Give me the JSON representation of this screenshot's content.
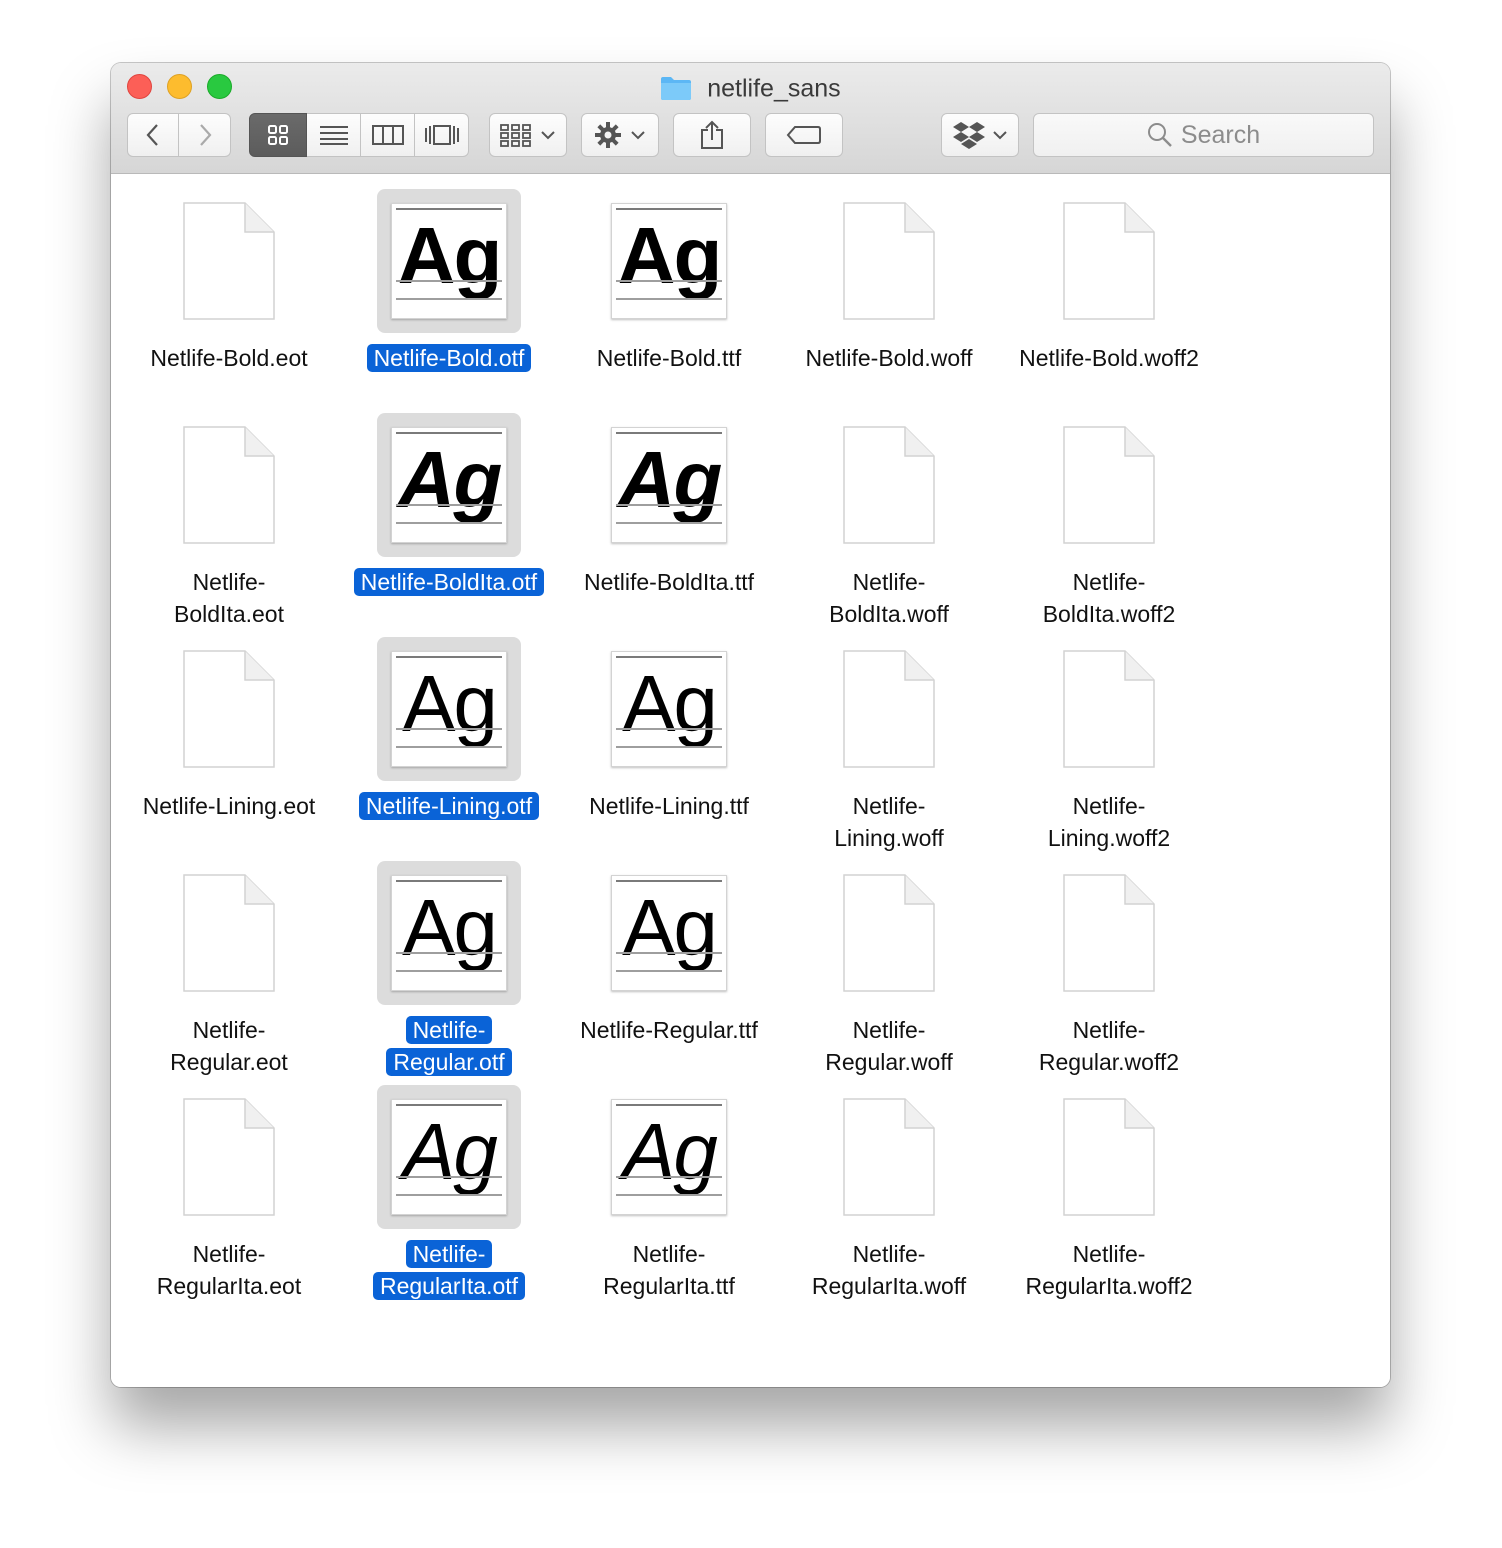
{
  "window": {
    "title": "netlife_sans"
  },
  "toolbar": {
    "back_icon": "chevron-left-icon",
    "forward_icon": "chevron-right-icon",
    "view_modes": [
      "icon-view",
      "list-view",
      "column-view",
      "cover-flow-view"
    ],
    "active_view": "icon-view",
    "search_placeholder": "Search"
  },
  "colors": {
    "selection": "#0a63d7",
    "selected_icon_bg": "#dcdcdc"
  },
  "files": [
    [
      {
        "name": "Netlife-Bold.eot",
        "lines": [
          "Netlife-Bold.eot"
        ],
        "kind": "doc",
        "selected": false
      },
      {
        "name": "Netlife-Bold.otf",
        "lines": [
          "Netlife-Bold.otf"
        ],
        "kind": "font",
        "style": "bold",
        "selected": true
      },
      {
        "name": "Netlife-Bold.ttf",
        "lines": [
          "Netlife-Bold.ttf"
        ],
        "kind": "font",
        "style": "bold",
        "selected": false
      },
      {
        "name": "Netlife-Bold.woff",
        "lines": [
          "Netlife-Bold.woff"
        ],
        "kind": "doc",
        "selected": false
      },
      {
        "name": "Netlife-Bold.woff2",
        "lines": [
          "Netlife-Bold.woff2"
        ],
        "kind": "doc",
        "selected": false
      }
    ],
    [
      {
        "name": "Netlife-BoldIta.eot",
        "lines": [
          "Netlife-",
          "BoldIta.eot"
        ],
        "kind": "doc",
        "selected": false
      },
      {
        "name": "Netlife-BoldIta.otf",
        "lines": [
          "Netlife-BoldIta.otf"
        ],
        "kind": "font",
        "style": "bolditalic",
        "selected": true
      },
      {
        "name": "Netlife-BoldIta.ttf",
        "lines": [
          "Netlife-BoldIta.ttf"
        ],
        "kind": "font",
        "style": "bolditalic",
        "selected": false
      },
      {
        "name": "Netlife-BoldIta.woff",
        "lines": [
          "Netlife-",
          "BoldIta.woff"
        ],
        "kind": "doc",
        "selected": false
      },
      {
        "name": "Netlife-BoldIta.woff2",
        "lines": [
          "Netlife-",
          "BoldIta.woff2"
        ],
        "kind": "doc",
        "selected": false
      }
    ],
    [
      {
        "name": "Netlife-Lining.eot",
        "lines": [
          "Netlife-Lining.eot"
        ],
        "kind": "doc",
        "selected": false
      },
      {
        "name": "Netlife-Lining.otf",
        "lines": [
          "Netlife-Lining.otf"
        ],
        "kind": "font",
        "style": "regular",
        "selected": true
      },
      {
        "name": "Netlife-Lining.ttf",
        "lines": [
          "Netlife-Lining.ttf"
        ],
        "kind": "font",
        "style": "regular",
        "selected": false
      },
      {
        "name": "Netlife-Lining.woff",
        "lines": [
          "Netlife-",
          "Lining.woff"
        ],
        "kind": "doc",
        "selected": false
      },
      {
        "name": "Netlife-Lining.woff2",
        "lines": [
          "Netlife-",
          "Lining.woff2"
        ],
        "kind": "doc",
        "selected": false
      }
    ],
    [
      {
        "name": "Netlife-Regular.eot",
        "lines": [
          "Netlife-",
          "Regular.eot"
        ],
        "kind": "doc",
        "selected": false
      },
      {
        "name": "Netlife-Regular.otf",
        "lines": [
          "Netlife-",
          "Regular.otf"
        ],
        "kind": "font",
        "style": "regular",
        "selected": true
      },
      {
        "name": "Netlife-Regular.ttf",
        "lines": [
          "Netlife-Regular.ttf"
        ],
        "kind": "font",
        "style": "regular",
        "selected": false
      },
      {
        "name": "Netlife-Regular.woff",
        "lines": [
          "Netlife-",
          "Regular.woff"
        ],
        "kind": "doc",
        "selected": false
      },
      {
        "name": "Netlife-Regular.woff2",
        "lines": [
          "Netlife-",
          "Regular.woff2"
        ],
        "kind": "doc",
        "selected": false
      }
    ],
    [
      {
        "name": "Netlife-RegularIta.eot",
        "lines": [
          "Netlife-",
          "RegularIta.eot"
        ],
        "kind": "doc",
        "selected": false
      },
      {
        "name": "Netlife-RegularIta.otf",
        "lines": [
          "Netlife-",
          "RegularIta.otf"
        ],
        "kind": "font",
        "style": "italic",
        "selected": true
      },
      {
        "name": "Netlife-RegularIta.ttf",
        "lines": [
          "Netlife-",
          "RegularIta.ttf"
        ],
        "kind": "font",
        "style": "italic",
        "selected": false
      },
      {
        "name": "Netlife-RegularIta.woff",
        "lines": [
          "Netlife-",
          "RegularIta.woff"
        ],
        "kind": "doc",
        "selected": false
      },
      {
        "name": "Netlife-RegularIta.woff2",
        "lines": [
          "Netlife-",
          "RegularIta.woff2"
        ],
        "kind": "doc",
        "selected": false
      }
    ]
  ],
  "glyph": "Ag"
}
